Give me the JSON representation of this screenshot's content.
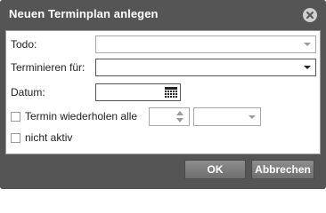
{
  "dialog": {
    "title": "Neuen Terminplan anlegen"
  },
  "form": {
    "todo_label": "Todo:",
    "todo_value": "",
    "schedule_for_label": "Terminieren für:",
    "schedule_for_value": "",
    "date_label": "Datum:",
    "date_value": "",
    "repeat_label": "Termin wiederholen alle",
    "repeat_checked": false,
    "repeat_interval_value": "",
    "repeat_unit_value": "",
    "inactive_label": "nicht aktiv",
    "inactive_checked": false
  },
  "buttons": {
    "ok": "OK",
    "cancel": "Abbrechen"
  },
  "icons": {
    "close": "close-icon",
    "calendar": "calendar-icon",
    "dropdown": "chevron-down-icon"
  },
  "colors": {
    "chrome": "#555555",
    "button": "#7f7f7f",
    "content": "#ffffff"
  }
}
